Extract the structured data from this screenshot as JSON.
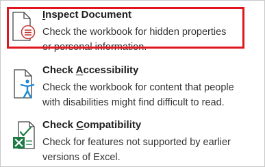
{
  "menu": {
    "items": [
      {
        "title_pre": "",
        "title_key": "I",
        "title_post": "nspect Document",
        "desc_line1": "Check the workbook for hidden properties",
        "desc_line2": "or personal information.",
        "icon": "inspect-document-icon",
        "highlighted": true
      },
      {
        "title_pre": "Check ",
        "title_key": "A",
        "title_post": "ccessibility",
        "desc_line1": "Check the workbook for content that people",
        "desc_line2": "with disabilities might find difficult to read.",
        "icon": "check-accessibility-icon",
        "highlighted": false
      },
      {
        "title_pre": "Check ",
        "title_key": "C",
        "title_post": "ompatibility",
        "desc_line1": "Check for features not supported by earlier",
        "desc_line2": "versions of Excel.",
        "icon": "check-compatibility-icon",
        "highlighted": false
      }
    ]
  },
  "colors": {
    "highlight_border": "#e0161e",
    "accessibility_blue": "#1e88d6",
    "excel_green": "#1d7a45",
    "icon_stroke": "#444444"
  }
}
